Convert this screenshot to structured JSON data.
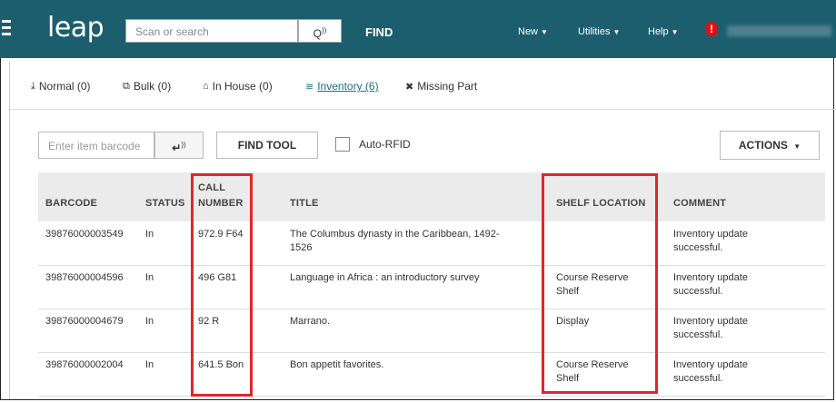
{
  "header": {
    "logo": "leap",
    "search_placeholder": "Scan or search",
    "find_label": "FIND",
    "nav": [
      {
        "label": "New"
      },
      {
        "label": "Utilities"
      },
      {
        "label": "Help"
      }
    ],
    "alert_glyph": "!"
  },
  "modes": [
    {
      "icon": "⤓",
      "label": "Normal (0)",
      "active": false
    },
    {
      "icon": "⧉",
      "label": "Bulk (0)",
      "active": false
    },
    {
      "icon": "⌂",
      "label": "In House (0)",
      "active": false
    },
    {
      "icon": "≋",
      "label": "Inventory (6)",
      "active": true
    },
    {
      "icon": "✖",
      "label": "Missing Part",
      "active": false
    }
  ],
  "toolbar": {
    "barcode_placeholder": "Enter item barcode",
    "enter_glyph": "↵",
    "find_tool_label": "FIND TOOL",
    "auto_rfid_label": "Auto-RFID",
    "actions_label": "ACTIONS"
  },
  "table": {
    "columns": {
      "barcode": "BARCODE",
      "status": "STATUS",
      "call_number_1": "CALL",
      "call_number_2": "NUMBER",
      "title": "TITLE",
      "shelf_location": "SHELF LOCATION",
      "comment": "COMMENT"
    },
    "rows": [
      {
        "barcode": "39876000003549",
        "status": "In",
        "call_number": "972.9 F64",
        "title_1": "The Columbus dynasty in the Caribbean, 1492-",
        "title_2": "1526",
        "shelf_1": "",
        "shelf_2": "",
        "comment_1": "Inventory update",
        "comment_2": "successful."
      },
      {
        "barcode": "39876000004596",
        "status": "In",
        "call_number": "496 G81",
        "title_1": "Language in Africa : an introductory survey",
        "title_2": "",
        "shelf_1": "Course Reserve",
        "shelf_2": "Shelf",
        "comment_1": "Inventory update",
        "comment_2": "successful."
      },
      {
        "barcode": "39876000004679",
        "status": "In",
        "call_number": "92 R",
        "title_1": "Marrano.",
        "title_2": "",
        "shelf_1": "Display",
        "shelf_2": "",
        "comment_1": "Inventory update",
        "comment_2": "successful."
      },
      {
        "barcode": "39876000002004",
        "status": "In",
        "call_number": "641.5 Bon",
        "title_1": "Bon appetit favorites.",
        "title_2": "",
        "shelf_1": "Course Reserve",
        "shelf_2": "Shelf",
        "comment_1": "Inventory update",
        "comment_2": "successful."
      }
    ]
  },
  "colors": {
    "header_bg": "#1d5e6e",
    "highlight": "#e0262b",
    "active_tab": "#1d6f84"
  }
}
